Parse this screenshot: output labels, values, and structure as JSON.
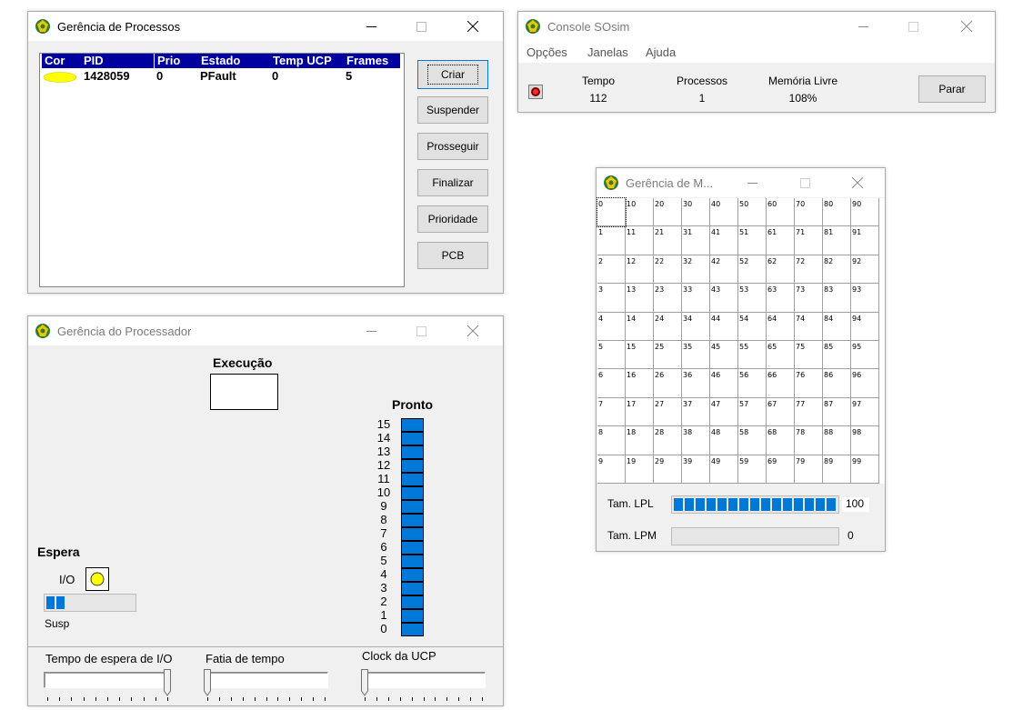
{
  "process_window": {
    "title": "Gerência de Processos",
    "columns": [
      "Cor",
      "PID",
      "Prio",
      "Estado",
      "Temp UCP",
      "Frames"
    ],
    "rows": [
      {
        "cor": "yellow",
        "pid": "1428059",
        "prio": "0",
        "estado": "PFault",
        "temp_ucp": "0",
        "frames": "5"
      }
    ],
    "buttons": {
      "criar": "Criar",
      "suspender": "Suspender",
      "prosseguir": "Prosseguir",
      "finalizar": "Finalizar",
      "prioridade": "Prioridade",
      "pcb": "PCB"
    }
  },
  "console_window": {
    "title": "Console SOsim",
    "menu": [
      "Opções",
      "Janelas",
      "Ajuda"
    ],
    "stats": {
      "tempo_label": "Tempo",
      "tempo_value": "112",
      "processos_label": "Processos",
      "processos_value": "1",
      "memoria_label": "Memória Livre",
      "memoria_value": "108%"
    },
    "parar_label": "Parar"
  },
  "memory_window": {
    "title": "Gerência de M...",
    "frames": [
      [
        "0",
        "10",
        "20",
        "30",
        "40",
        "50",
        "60",
        "70",
        "80",
        "90"
      ],
      [
        "1",
        "11",
        "21",
        "31",
        "41",
        "51",
        "61",
        "71",
        "81",
        "91"
      ],
      [
        "2",
        "12",
        "22",
        "32",
        "42",
        "52",
        "62",
        "72",
        "82",
        "92"
      ],
      [
        "3",
        "13",
        "23",
        "33",
        "43",
        "53",
        "63",
        "73",
        "83",
        "93"
      ],
      [
        "4",
        "14",
        "24",
        "34",
        "44",
        "54",
        "64",
        "74",
        "84",
        "94"
      ],
      [
        "5",
        "15",
        "25",
        "35",
        "45",
        "55",
        "65",
        "75",
        "85",
        "95"
      ],
      [
        "6",
        "16",
        "26",
        "36",
        "46",
        "56",
        "66",
        "76",
        "86",
        "96"
      ],
      [
        "7",
        "17",
        "27",
        "37",
        "47",
        "57",
        "67",
        "77",
        "87",
        "97"
      ],
      [
        "8",
        "18",
        "28",
        "38",
        "48",
        "58",
        "68",
        "78",
        "88",
        "98"
      ],
      [
        "9",
        "19",
        "29",
        "39",
        "49",
        "59",
        "69",
        "79",
        "89",
        "99"
      ]
    ],
    "lpl_label": "Tam. LPL",
    "lpl_value": "100",
    "lpl_fill": 1.0,
    "lpm_label": "Tam. LPM",
    "lpm_value": "0",
    "lpm_fill": 0.0
  },
  "processor_window": {
    "title": "Gerência do Processador",
    "execucao_label": "Execução",
    "pronto_label": "Pronto",
    "pronto_levels": [
      "15",
      "14",
      "13",
      "12",
      "11",
      "10",
      "9",
      "8",
      "7",
      "6",
      "5",
      "4",
      "3",
      "2",
      "1",
      "0"
    ],
    "espera_label": "Espera",
    "io_label": "I/O",
    "susp_label": "Susp",
    "susp_fill_segments": 2,
    "sliders": {
      "espera_io_label": "Tempo de espera de I/O",
      "espera_io_value": 1.0,
      "fatia_label": "Fatia de tempo",
      "fatia_value": 0.0,
      "clock_label": "Clock da UCP",
      "clock_value": 0.0
    }
  },
  "colors": {
    "accent_blue": "#0078d7",
    "header_blue": "#0000a0",
    "process_yellow": "#ffff00"
  }
}
